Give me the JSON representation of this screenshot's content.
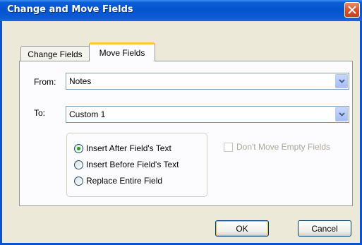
{
  "window": {
    "title": "Change and Move Fields"
  },
  "tabs": [
    {
      "label": "Change Fields",
      "selected": false
    },
    {
      "label": "Move Fields",
      "selected": true
    }
  ],
  "from": {
    "label": "From:",
    "value": "Notes"
  },
  "to": {
    "label": "To:",
    "value": "Custom 1"
  },
  "insert_options": [
    {
      "label": "Insert After Field's Text",
      "selected": true
    },
    {
      "label": "Insert Before Field's Text",
      "selected": false
    },
    {
      "label": "Replace Entire Field",
      "selected": false
    }
  ],
  "dont_move_empty": {
    "label": "Don't Move Empty Fields",
    "checked": false,
    "enabled": false
  },
  "buttons": {
    "ok": "OK",
    "cancel": "Cancel"
  },
  "colors": {
    "titlebar": "#0453cf",
    "close": "#d8522c",
    "radio_dot": "#21a121",
    "tab_highlight": "#ffc83c"
  }
}
